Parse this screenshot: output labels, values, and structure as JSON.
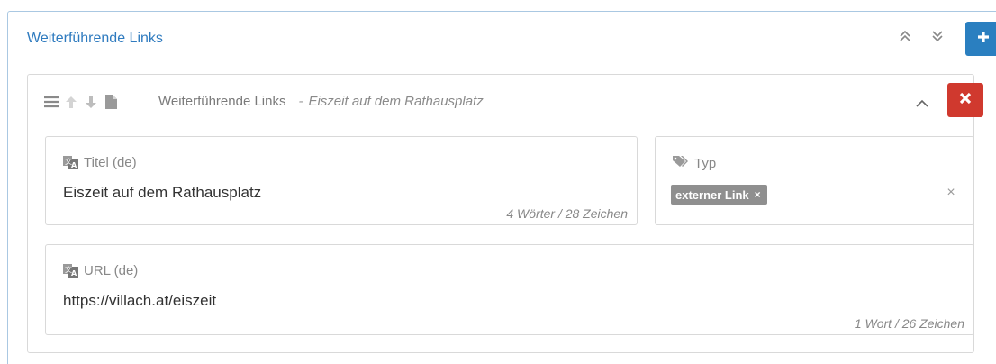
{
  "section": {
    "title": "Weiterführende Links",
    "add_label": "+"
  },
  "entry": {
    "type_label": "Weiterführende Links",
    "separator": "-",
    "subtitle": "Eiszeit auf dem Rathausplatz"
  },
  "fields": {
    "titel": {
      "label": "Titel (de)",
      "value": "Eiszeit auf dem Rathausplatz",
      "count": "4 Wörter / 28 Zeichen"
    },
    "typ": {
      "label": "Typ",
      "tag": "externer Link",
      "tag_remove": "×",
      "clear": "×"
    },
    "url": {
      "label": "URL (de)",
      "value": "https://villach.at/eiszeit",
      "count": "1 Wort / 26 Zeichen"
    }
  },
  "colors": {
    "accent": "#2a7fc0",
    "danger": "#d0392e",
    "tag": "#8f8f8f"
  }
}
